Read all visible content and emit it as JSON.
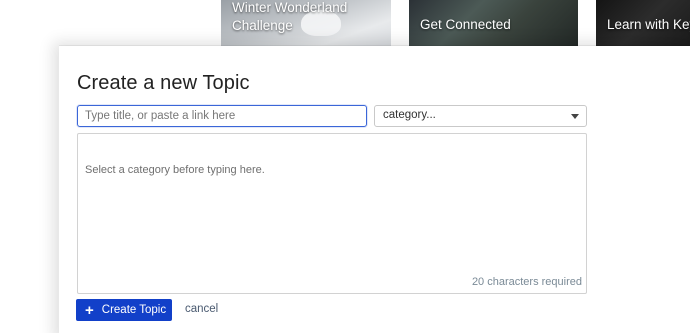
{
  "banner": {
    "cards": [
      {
        "title_line1": "Winter Wonderland",
        "title_line2": "Challenge"
      },
      {
        "title": "Get Connected"
      },
      {
        "title": "Learn with Key"
      }
    ]
  },
  "composer": {
    "title": "Create a new Topic",
    "title_placeholder": "Type title, or paste a link here",
    "category_value": "category...",
    "editor_placeholder": "Select a category before typing here.",
    "char_requirement": "20 characters required",
    "create_label": "Create Topic",
    "create_icon": "+",
    "cancel_label": "cancel"
  },
  "colors": {
    "primary": "#1240c9",
    "focus_border": "#3b66d8",
    "muted_text": "#7a8a96"
  }
}
